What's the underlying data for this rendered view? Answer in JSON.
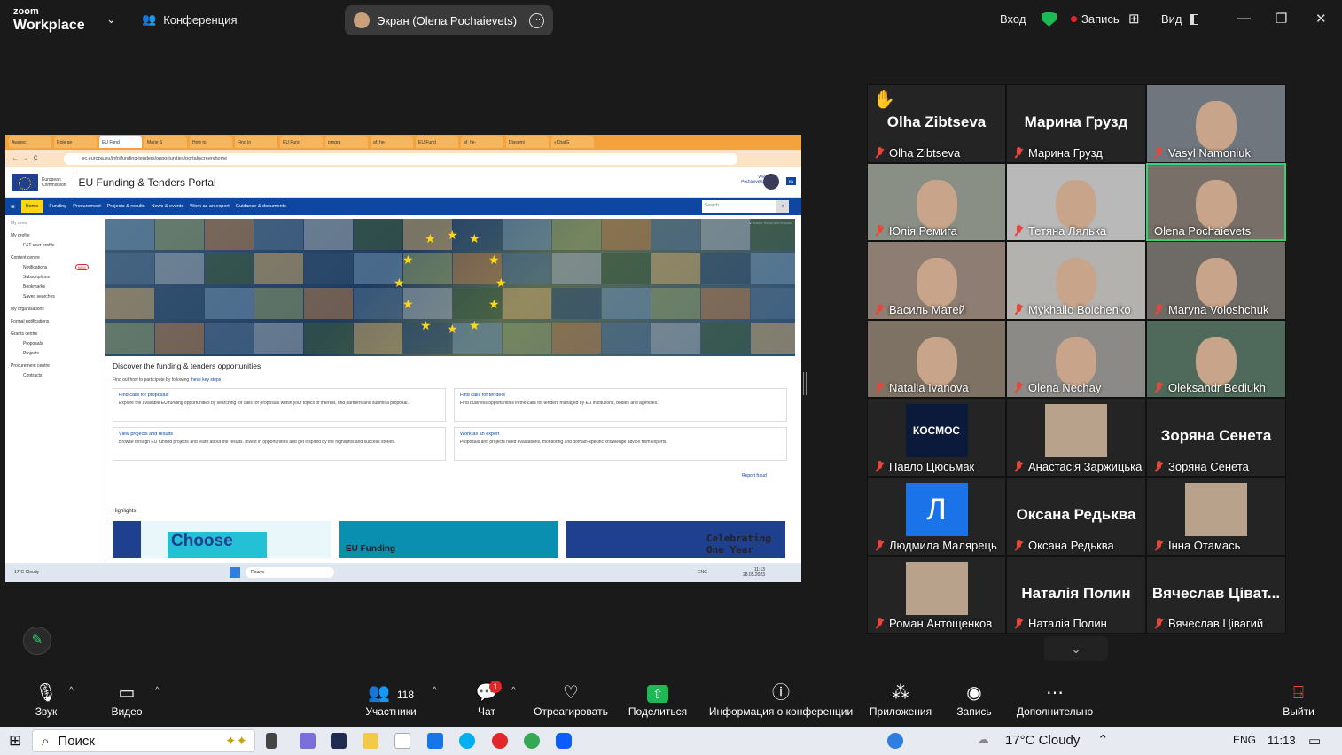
{
  "zoom": {
    "logo_top": "zoom",
    "logo_bottom": "Workplace",
    "meeting_label": "Конференция",
    "screen_label": "Экран (Olena Pochaievets)",
    "enter": "Вход",
    "record": "Запись",
    "view": "Вид"
  },
  "browser": {
    "tabs": [
      "Awarec",
      "Role ge",
      "EU Fund",
      "Marie S",
      "How to",
      "Find jo",
      "EU Fund",
      "progra",
      "af_he-",
      "EU Fund",
      "af_he-",
      "Dissemi",
      "«ChatG"
    ],
    "url": "ec.europa.eu/info/funding-tenders/opportunities/portal/screen/home",
    "portal_title": "EU Funding & Tenders Portal",
    "ec_line1": "European",
    "ec_line2": "Commission",
    "welcome": "Welcome",
    "user": "Pochaievets Olena",
    "lang": "EN",
    "nav": [
      "Home",
      "Funding",
      "Procurement",
      "Projects & results",
      "News & events",
      "Work as an expert",
      "Guidance & documents"
    ],
    "search_placeholder": "Search...",
    "hero_credit": "© Adobe Stock and Envato",
    "sidebar": {
      "my_area": "My area",
      "my_profile": "My profile",
      "ft_user": "F&T user profile",
      "content_centre": "Content centre",
      "notifications": "Notifications",
      "new_badge": "NEW",
      "subscriptions": "Subscriptions",
      "bookmarks": "Bookmarks",
      "saved": "Saved searches",
      "my_orgs": "My organisations",
      "formal": "Formal notifications",
      "grants": "Grants centre",
      "proposals": "Proposals",
      "projects": "Projects",
      "procurement": "Procurement centre",
      "contracts": "Contracts"
    },
    "discover_title": "Discover the funding & tenders opportunities",
    "discover_sub": "Find out how to participate by following",
    "key_steps": "these key steps",
    "cards": [
      {
        "h": "Find calls for proposals",
        "d": "Explore the available EU funding opportunities by searching for calls for proposals within your topics of interest, find partners and submit a proposal."
      },
      {
        "h": "Find calls for tenders",
        "d": "Find business opportunities in the calls for tenders managed by EU institutions, bodies and agencies."
      },
      {
        "h": "View projects and results",
        "d": "Browse through EU funded projects and learn about the results. Invest in opportunities and get inspired by the highlights and success stories."
      },
      {
        "h": "Work as an expert",
        "d": "Proposals and projects need evaluations, monitoring and domain-specific knowledge advice from experts."
      }
    ],
    "report_fraud": "Report fraud",
    "highlights": "Highlights",
    "hl1": "Choose",
    "hl2": "EU Funding",
    "hl3": "Celebrating One Year",
    "weather_temp": "17°C",
    "weather_txt": "Cloudy",
    "task_search": "Пошук",
    "lang_ua": "ENG",
    "time": "11:13",
    "date": "28.05.2023"
  },
  "participants": [
    {
      "name": "Olha Zibtseva",
      "big": "Olha Zibtseva",
      "hand": true
    },
    {
      "name": "Марина Грузд",
      "big": "Марина Грузд"
    },
    {
      "name": "Vasyl Namoniuk",
      "video": true
    },
    {
      "name": "Юлія Ремига",
      "video": true
    },
    {
      "name": "Тетяна Лялька",
      "video": true
    },
    {
      "name": "Olena Pochaievets",
      "video": true,
      "active": true,
      "nomic": true
    },
    {
      "name": "Василь Матей",
      "video": true
    },
    {
      "name": "Mykhailo Boichenko",
      "video": true
    },
    {
      "name": "Maryna Voloshchuk",
      "video": true
    },
    {
      "name": "Natalia Ivanova",
      "video": true
    },
    {
      "name": "Olena Nechay",
      "video": true
    },
    {
      "name": "Oleksandr Bediukh",
      "video": true
    },
    {
      "name": "Павло Цюсьмак",
      "pic": "КОСМОС"
    },
    {
      "name": "Анастасія Заржицька",
      "pic": ""
    },
    {
      "name": "Зоряна Сенета",
      "big": "Зоряна Сенета"
    },
    {
      "name": "Людмила Малярець",
      "pic": "Л"
    },
    {
      "name": "Оксана Редьква",
      "big": "Оксана Редьква"
    },
    {
      "name": "Інна Отамась",
      "pic": ""
    },
    {
      "name": "Роман Антощенков",
      "pic": ""
    },
    {
      "name": "Наталія Полин",
      "big": "Наталія Полин"
    },
    {
      "name": "Вячеслав Цівагий",
      "big": "Вячеслав  Цівaт..."
    }
  ],
  "controls": {
    "sound": "Звук",
    "video": "Видео",
    "participants": "Участники",
    "participants_count": "118",
    "chat": "Чат",
    "chat_badge": "1",
    "react": "Отреагировать",
    "share": "Поделиться",
    "info": "Информация о конференции",
    "apps": "Приложения",
    "record": "Запись",
    "more": "Дополнительно",
    "leave": "Выйти"
  },
  "taskbar": {
    "search": "Поиск",
    "weather": "17°C  Cloudy",
    "lang": "ENG",
    "time": "11:13"
  },
  "colors": {
    "accent": "#2ed573",
    "zoom_blue": "#0b5cff",
    "eu_blue": "#0e47a1",
    "danger": "#e02828"
  }
}
